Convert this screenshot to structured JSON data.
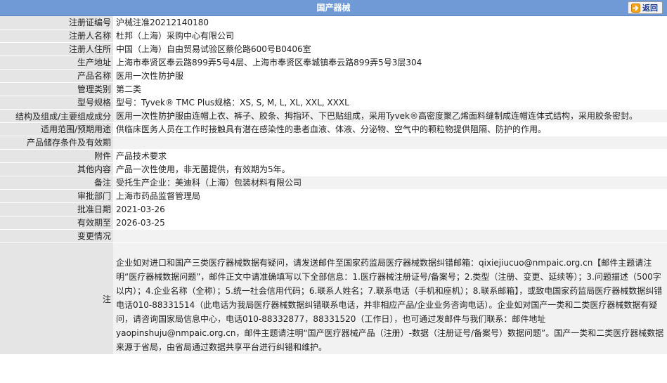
{
  "header": {
    "title": "国产器械",
    "back_label": "返回",
    "back_icon": "arrow-right-icon",
    "bar_color": "#6f9ad6"
  },
  "fields": [
    {
      "label": "注册证编号",
      "value": "沪械注准20212140180"
    },
    {
      "label": "注册人名称",
      "value": "杜邦（上海）采购中心有限公司"
    },
    {
      "label": "注册人住所",
      "value": "中国（上海）自由贸易试验区蔡伦路600号B0406室"
    },
    {
      "label": "生产地址",
      "value": "上海市奉贤区奉云路899弄5号4层、上海市奉贤区奉城镇奉云路899弄5号3层304"
    },
    {
      "label": "产品名称",
      "value": "医用一次性防护服"
    },
    {
      "label": "管理类别",
      "value": "第二类"
    },
    {
      "label": "型号规格",
      "value": "型号：Tyvek® TMC Plus规格：XS, S, M, L, XL, XXL, XXXL"
    },
    {
      "label": "结构及组成/主要组成成分",
      "value": "医用一次性防护服由连帽上衣、裤子、胶条、拇指环、下巴贴组成，采用Tyvek®高密度聚乙烯面料缝制成连帽连体式结构，采用胶条密封。"
    },
    {
      "label": "适用范围/预期用途",
      "value": "供临床医务人员在工作时接触具有潜在感染性的患者血液、体液、分泌物、空气中的颗粒物提供阻隔、防护的作用。"
    },
    {
      "label": "产品储存条件及有效期",
      "value": ""
    },
    {
      "label": "附件",
      "value": "产品技术要求"
    },
    {
      "label": "其他内容",
      "value": "产品一次性使用，非无菌提供，有效期为5年。"
    },
    {
      "label": "备注",
      "value": "受托生产企业：美迪科（上海）包装材料有限公司"
    },
    {
      "label": "审批部门",
      "value": "上海市药品监督管理局"
    },
    {
      "label": "批准日期",
      "value": "2021-03-26"
    },
    {
      "label": "有效期至",
      "value": "2026-03-25"
    },
    {
      "label": "变更情况",
      "value": ""
    }
  ],
  "note": {
    "label": "注",
    "text": "企业如对进口和国产三类医疗器械数据有疑问，请发送邮件至国家药监局医疗器械数据纠错邮箱：qixiejiucuo@nmpaic.org.cn【邮件主题请注明“医疗器械数据问题”，邮件正文中请准确填写以下全部信息：1.医疗器械注册证号/备案号；2.类型（注册、变更、延续等）；3.问题描述（500字以内）；4.企业名称（全称）；5.统一社会信用代码；6.联系人姓名；7.联系电话（手机和座机）；8.联系邮箱】，或致电国家药监局医疗器械数据纠错电话010-88331514（此电话为我局医疗器械数据纠错联系电话，并非相应产品/企业业务咨询电话）。企业如对国产一类和二类医疗器械数据有疑问，请咨询国家局信息中心，电话010-88332877，88331520（工作日），也可通过发邮件与我们联系：邮件地址yaopinshuju@nmpaic.org.cn，邮件主题请注明“国产医疗器械产品（注册）-数据（注册证号/备案号）数据问题”。国产一类和二类医疗器械数据来源于省局，由省局通过数据共享平台进行纠错和维护。"
  }
}
